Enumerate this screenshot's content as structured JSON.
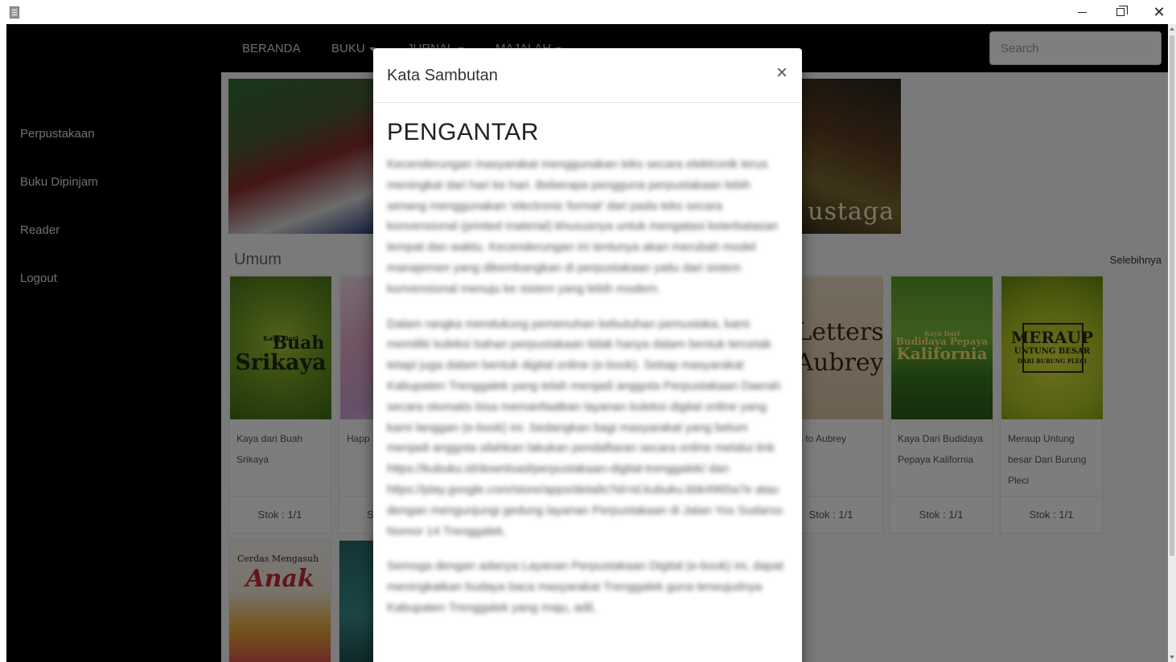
{
  "window": {
    "minimize": "–",
    "restore": "",
    "close": "✕"
  },
  "sidebar": {
    "items": [
      {
        "label": "Perpustakaan"
      },
      {
        "label": "Buku Dipinjam"
      },
      {
        "label": "Reader"
      },
      {
        "label": "Logout"
      }
    ]
  },
  "nav": {
    "items": [
      {
        "label": "BERANDA"
      },
      {
        "label": "BUKU"
      },
      {
        "label": "JURNAL"
      },
      {
        "label": "MAJALAH"
      }
    ],
    "search_placeholder": "Search"
  },
  "banner": {
    "text": "ustaga"
  },
  "section": {
    "title": "Umum",
    "more": "Selebihnya"
  },
  "books": [
    {
      "title": "Kaya dari Buah Srikaya",
      "stock": "Stok : 1/1",
      "cover_line1": "Buah",
      "cover_line2": "Srikaya",
      "cover_top": "Kaya Dari"
    },
    {
      "title": "Happ",
      "stock": "S",
      "cover_line1": "",
      "cover_line2": "",
      "cover_top": ""
    },
    {
      "title": "ters to Aubrey",
      "stock": "Stok : 1/1",
      "cover_line1": "Letters",
      "cover_line2": "Aubrey",
      "cover_top": ""
    },
    {
      "title": "Kaya Dari Budidaya Pepaya Kalifornia",
      "stock": "Stok : 1/1",
      "cover_line1": "Budidaya Pepaya",
      "cover_line2": "Kalifornia",
      "cover_top": "Kaya Dari"
    },
    {
      "title": "Meraup Untung besar Dari Burung Pleci",
      "stock": "Stok : 1/1",
      "cover_line1": "MERAUP",
      "cover_line2": "UNTUNG BESAR",
      "cover_top": "DARI BURUNG PLECI"
    }
  ],
  "row2": [
    {
      "cover_line1": "Cerdas Mengasuh",
      "cover_line2": "Anak"
    }
  ],
  "modal": {
    "title": "Kata Sambutan",
    "close": "×",
    "heading": "PENGANTAR",
    "paragraphs": [
      "Kecenderungan masyarakat menggunakan teks secara elektronik terus meningkat dari hari ke hari. Beberapa pengguna perpustakaan lebih senang menggunakan 'electronic format' dari pada teks secara konvensional (printed material) khususnya untuk mengatasi keterbatasan tempat dan waktu. Kecenderungan ini tentunya akan merubah model manajemen yang dikembangkan di perpustakaan yaitu dari sistem konvensional menuju ke sistem yang lebih modern.",
      "Dalam rangka mendukung pemenuhan kebutuhan pemustaka, kami memiliki koleksi bahan perpustakaan tidak hanya dalam bentuk tercetak tetapi juga dalam bentuk digital online (e-book). Setiap masyarakat Kabupaten Trenggalek yang telah menjadi anggota Perpustakaan Daerah secara otomatis bisa memanfaatkan layanan koleksi digital online yang kami langgan (e-book) ini. Sedangkan bagi masyarakat yang belum menjadi anggota silahkan lakukan pendaftaran secara online melalui link https://kubuku.id/download/perpustakaan-digital-trenggalek/ dan https://play.google.com/store/apps/details?id=id.kubuku.kbk4965a7e atau dengan mengunjungi gedung layanan Perpustakaan di Jalan Yos Sudarso Nomor 14 Trenggalek.",
      "Semoga dengan adanya Layanan Perpustakaan Digital (e-book) ini, dapat meningkatkan budaya baca masyarakat Trenggalek guna terwujudnya Kabupaten Trenggalek yang maju, adil,"
    ]
  }
}
